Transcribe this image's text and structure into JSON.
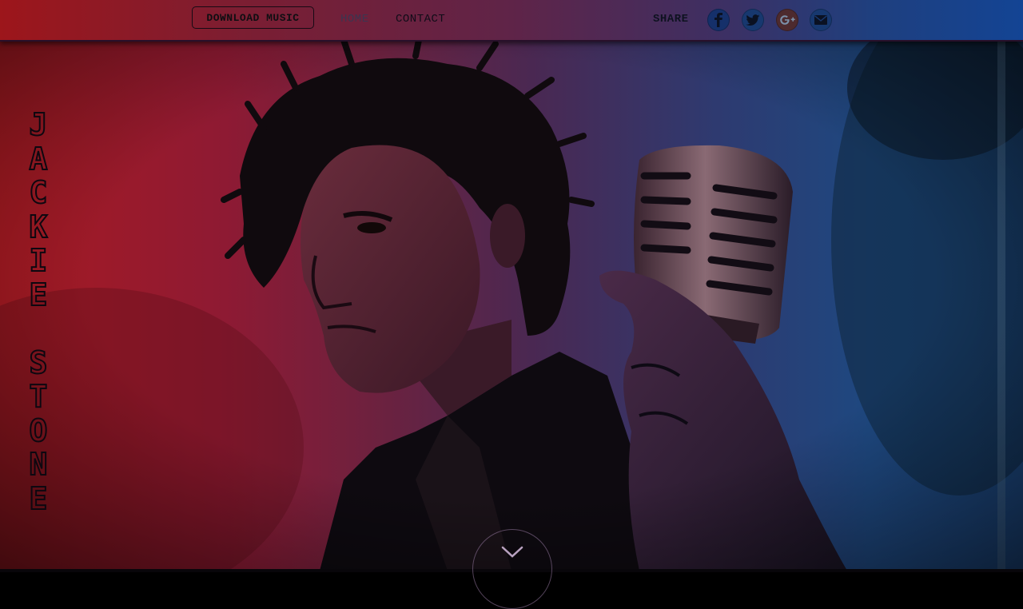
{
  "nav": {
    "download_label": "DOWNLOAD MUSIC",
    "home_label": "HOME",
    "contact_label": "CONTACT",
    "share_label": "SHARE",
    "social_icons": [
      "facebook-icon",
      "twitter-icon",
      "google-plus-icon",
      "email-icon"
    ]
  },
  "hero": {
    "artist_letters": [
      "J",
      "A",
      "C",
      "K",
      "I",
      "E",
      " ",
      "S",
      "T",
      "O",
      "N",
      "E"
    ],
    "scroll_icon": "chevron-down-icon"
  },
  "colors": {
    "gradient_left": "#a71a22",
    "gradient_right": "#1b4377",
    "text_dark": "#0e0e12",
    "nav_home": "#3c3550"
  }
}
